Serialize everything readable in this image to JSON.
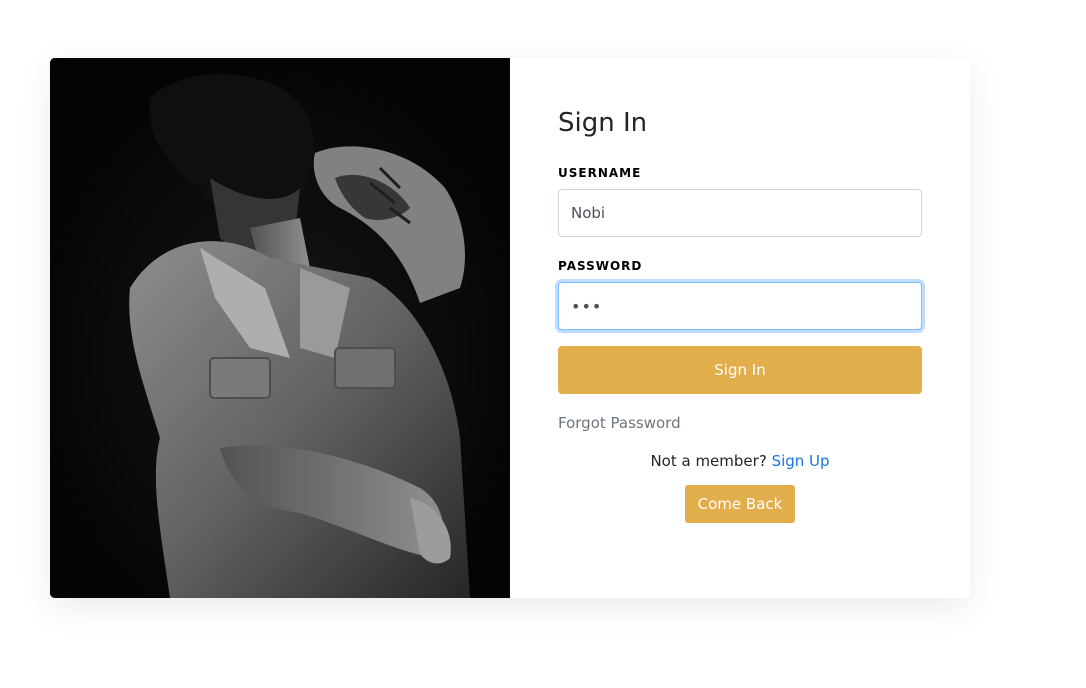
{
  "form": {
    "title": "Sign In",
    "username_label": "USERNAME",
    "username_value": "Nobi",
    "password_label": "PASSWORD",
    "password_display": "•••",
    "submit_label": "Sign In",
    "forgot_label": "Forgot Password",
    "member_prompt": "Not a member?",
    "signup_label": "Sign Up",
    "come_back_label": "Come Back"
  },
  "colors": {
    "accent": "#e2ae4b",
    "link": "#1a73e8",
    "muted": "#6c757d",
    "focus_border": "#80bdff"
  },
  "photo": {
    "icon": "person-photo"
  }
}
